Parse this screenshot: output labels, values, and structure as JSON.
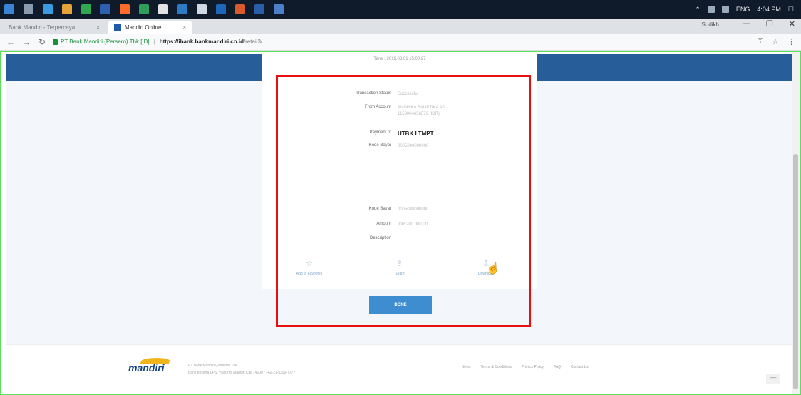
{
  "taskbar": {
    "apps": [
      "#3a84d6",
      "#8a9bb0",
      "#3b9be0",
      "#e8a23a",
      "#2fa84f",
      "#2f5fb0",
      "#ff6b2b",
      "#2f9e5a",
      "#e3e3e3",
      "#2a7cc7",
      "#d0d8e3",
      "#1e66b8",
      "#d85a2a",
      "#2b5ea8",
      "#4c7ec9"
    ],
    "lang": "ENG",
    "time": "4:04 PM"
  },
  "browser": {
    "tab_inactive": "Bank Mandiri - Terpercaya",
    "tab_active": "Mandiri Online",
    "user": "Sudikh",
    "url_org": "PT Bank Mandiri (Persero) Tbk [ID]",
    "url_host": "https://ibank.bankmandiri.co.id",
    "url_path": "/retail3/"
  },
  "receipt": {
    "time": "Time : 2019.03.01 15:00:27",
    "transaction_status_label": "Transaction Status",
    "transaction_status_value": "Successful",
    "from_account_label": "From Account",
    "from_account_value": "ANDHIKA SAUPTIKA AJI - 1150004656572 (IDR)",
    "payment_to_label": "Payment to",
    "payment_to_value": "UTBK LTMPT",
    "kode_bayar_label": "Kode Bayar",
    "kode_bayar_value": "0005040000000",
    "kode_bayar2_label": "Kode Bayar",
    "kode_bayar2_value": "0005040000000",
    "amount_label": "Amount",
    "amount_value": "IDR 200.000,00",
    "description_label": "Description"
  },
  "actions": {
    "favorite": "Add to Favorites",
    "share": "Share",
    "download": "Download"
  },
  "done_label": "DONE",
  "footer": {
    "logo": "mandiri",
    "line1": "PT Bank Mandiri (Persero) Tbk",
    "line2": "Bank peserta LPS. Hubungi Mandiri Call 14000 / +62-21-5299-7777",
    "links": [
      "News",
      "Terms & Conditions",
      "Privacy Policy",
      "FAQ",
      "Contact Us"
    ]
  }
}
